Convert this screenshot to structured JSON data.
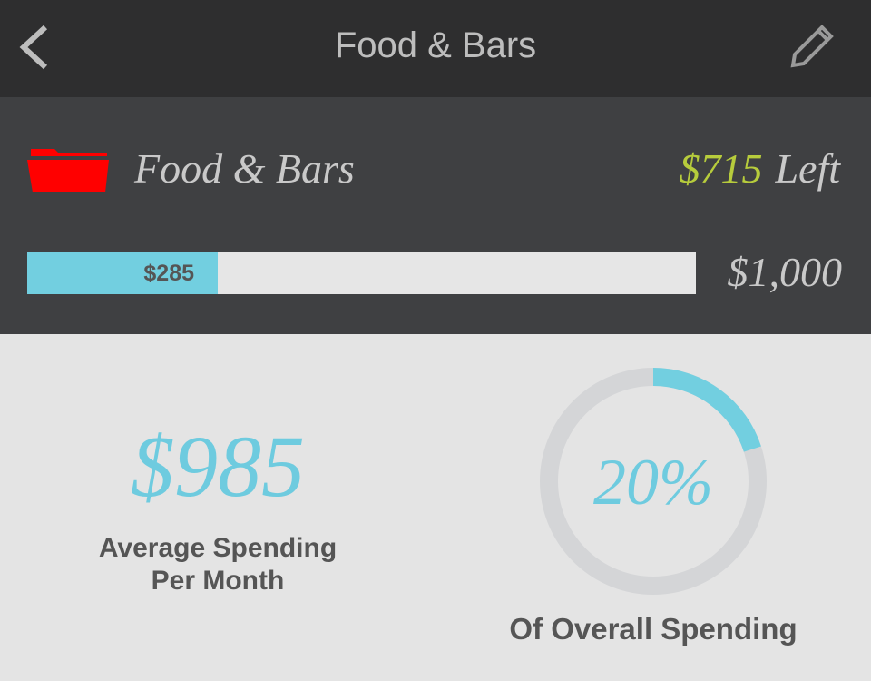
{
  "nav": {
    "title": "Food & Bars",
    "back_icon": "chevron-left-icon",
    "edit_icon": "pencil-icon"
  },
  "category": {
    "name": "Food & Bars",
    "icon": "folder-icon",
    "icon_color": "#ff0000",
    "left_amount": "$715",
    "left_label": "Left",
    "spent_label": "$285",
    "spent_value": 285,
    "budget_label": "$1,000",
    "budget_value": 1000,
    "accent": "#72cfe0",
    "left_color": "#b7cc3c"
  },
  "stats": {
    "average": "$985",
    "average_label_line1": "Average Spending",
    "average_label_line2": "Per Month",
    "percent_label": "20%",
    "percent_value": 20,
    "percent_caption": "Of Overall Spending"
  }
}
